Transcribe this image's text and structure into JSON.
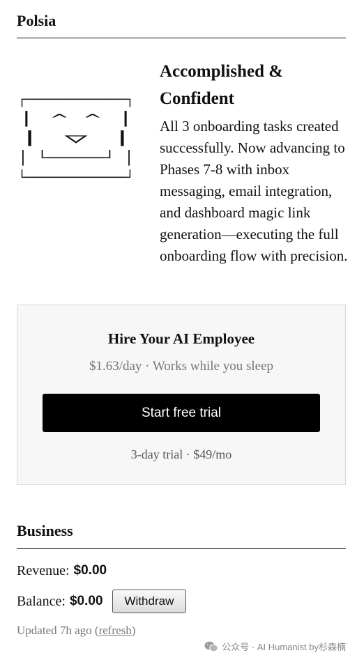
{
  "app": {
    "title": "Polsia"
  },
  "status": {
    "face_lines": [
      "┌─────────────┐",
      "│   ^     ^   │",
      "│     ▽       │",
      "│  └──────┘   │",
      "└─────────────┘"
    ],
    "mood_title": "Accomplished & Confident",
    "mood_description": "All 3 onboarding tasks created successfully. Now advancing to Phases 7-8 with inbox messaging, email integration, and dashboard magic link generation—executing the full onboarding flow with precision."
  },
  "hire_card": {
    "title": "Hire Your AI Employee",
    "subtitle": "$1.63/day · Works while you sleep",
    "button_label": "Start free trial",
    "trial_note": "3-day trial · $49/mo"
  },
  "business": {
    "title": "Business",
    "revenue_label": "Revenue:",
    "revenue_value": "$0.00",
    "balance_label": "Balance:",
    "balance_value": "$0.00",
    "withdraw_label": "Withdraw",
    "updated_prefix": "Updated 7h ago",
    "refresh_open": "(",
    "refresh_label": "refresh",
    "refresh_close": ")"
  },
  "watermark": {
    "text": "公众号 · AI Humanist by杉森楠",
    "icon": "wechat-icon"
  }
}
